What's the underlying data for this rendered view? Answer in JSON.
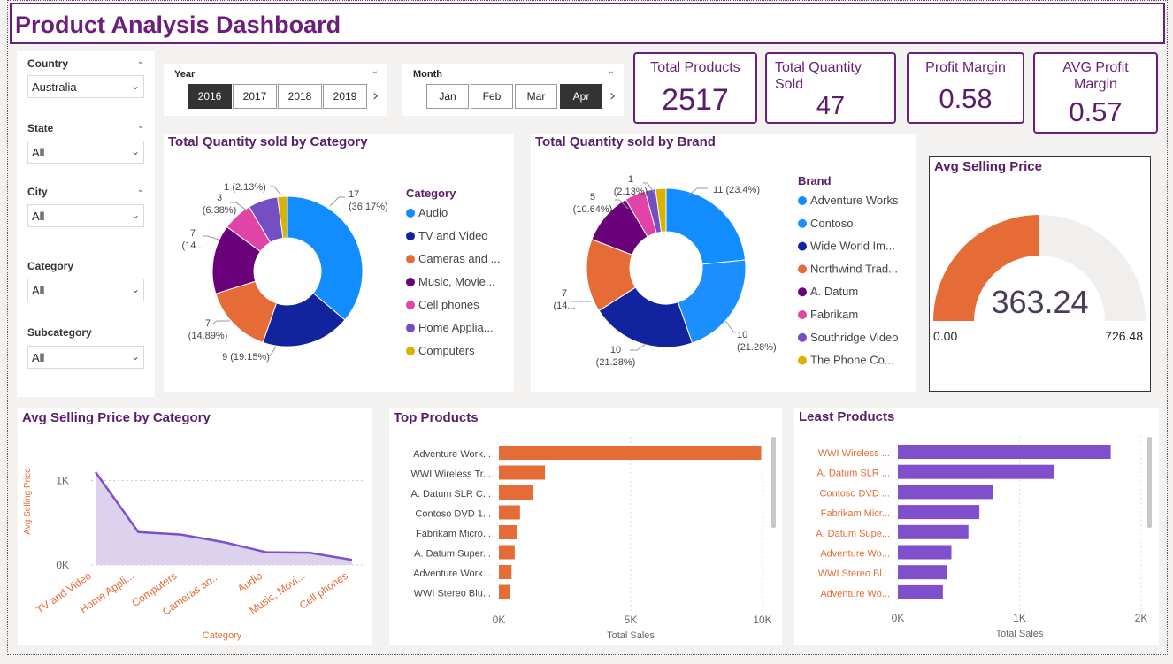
{
  "title": "Product Analysis Dashboard",
  "slicers": [
    {
      "label": "Country",
      "value": "Australia"
    },
    {
      "label": "State",
      "value": "All"
    },
    {
      "label": "City",
      "value": "All"
    },
    {
      "label": "Category",
      "value": "All"
    },
    {
      "label": "Subcategory",
      "value": "All"
    }
  ],
  "year": {
    "label": "Year",
    "options": [
      "2016",
      "2017",
      "2018",
      "2019"
    ],
    "selected": "2016"
  },
  "month": {
    "label": "Month",
    "options": [
      "Jan",
      "Feb",
      "Mar",
      "Apr"
    ],
    "selected": "Apr"
  },
  "kpis": [
    {
      "label": "Total Products",
      "value": "2517"
    },
    {
      "label": "Total Quantity Sold",
      "value": "47"
    },
    {
      "label": "Profit Margin",
      "value": "0.58"
    },
    {
      "label": "AVG Profit Margin",
      "value": "0.57"
    }
  ],
  "gauge": {
    "title": "Avg Selling Price",
    "value_text": "363.24",
    "min": "0.00",
    "max": "726.48",
    "fill_fraction": 0.5
  },
  "colors": {
    "accent": "#6b1e7a",
    "Audio": "#118dff",
    "TV and Video": "#12239e",
    "Cameras": "#e66c37",
    "Music": "#6b007b",
    "Cell phones": "#e044a7",
    "Home": "#744ec2",
    "Computers": "#d9b300",
    "orange_bar": "#e66c37",
    "purple_bar": "#7f4fcc"
  },
  "chart_data": [
    {
      "type": "pie",
      "title": "Total Quantity sold by Category",
      "legend_title": "Category",
      "categories": [
        "Audio",
        "TV and Video",
        "Cameras and ...",
        "Music, Movie...",
        "Cell phones",
        "Home Applia...",
        "Computers"
      ],
      "values": [
        17,
        9,
        7,
        7,
        3,
        3,
        1
      ],
      "labels": [
        {
          "l1": "17",
          "l2": "(36.17%)"
        },
        {
          "l1": "9 (19.15%)",
          "l2": ""
        },
        {
          "l1": "7",
          "l2": "(14.89%)"
        },
        {
          "l1": "7",
          "l2": "(14..."
        },
        {
          "l1": "3",
          "l2": "(6.38%)"
        },
        {
          "l1": "1 (2.13%)",
          "l2": ""
        }
      ]
    },
    {
      "type": "pie",
      "title": "Total Quantity sold by Brand",
      "legend_title": "Brand",
      "categories": [
        "Adventure Works",
        "Contoso",
        "Wide World Im...",
        "Northwind Trad...",
        "A. Datum",
        "Fabrikam",
        "Southridge Video",
        "The Phone Co..."
      ],
      "values": [
        11,
        10,
        10,
        7,
        5,
        2,
        1,
        1
      ],
      "labels": [
        {
          "l1": "11 (23.4%)",
          "l2": ""
        },
        {
          "l1": "10",
          "l2": "(21.28%)"
        },
        {
          "l1": "10",
          "l2": "(21.28%)"
        },
        {
          "l1": "7",
          "l2": "(14..."
        },
        {
          "l1": "5",
          "l2": "(10.64%)"
        },
        {
          "l1": "1",
          "l2": "(2.13%)"
        }
      ]
    },
    {
      "type": "area",
      "title": "Avg Selling Price by Category",
      "xlabel": "Category",
      "ylabel": "Avg Selling Price",
      "categories": [
        "TV and Video",
        "Home Appli...",
        "Computers",
        "Cameras an...",
        "Audio",
        "Music, Movi...",
        "Cell phones"
      ],
      "values": [
        1100,
        390,
        360,
        270,
        150,
        145,
        60
      ],
      "yticks": [
        "0K",
        "1K"
      ],
      "ylim": [
        0,
        1100
      ]
    },
    {
      "type": "bar",
      "title": "Top Products",
      "xlabel": "Total Sales",
      "categories": [
        "Adventure Work...",
        "WWI Wireless Tr...",
        "A. Datum SLR C...",
        "Contoso DVD 1...",
        "Fabrikam Micro...",
        "A. Datum Super...",
        "Adventure Work...",
        "WWI Stereo Blu..."
      ],
      "values": [
        9950,
        1750,
        1300,
        800,
        680,
        600,
        480,
        420
      ],
      "xticks": [
        "0K",
        "5K",
        "10K"
      ],
      "xlim": [
        0,
        10000
      ]
    },
    {
      "type": "bar",
      "title": "Least Products",
      "xlabel": "Total Sales",
      "categories": [
        "WWI Wireless ...",
        "A. Datum SLR ...",
        "Contoso DVD ...",
        "Fabrikam Micr...",
        "A. Datum Supe...",
        "Adventure Wo...",
        "WWI Stereo Bl...",
        "Adventure Wo..."
      ],
      "values": [
        1750,
        1280,
        780,
        670,
        580,
        440,
        400,
        370
      ],
      "xticks": [
        "0K",
        "1K",
        "2K"
      ],
      "xlim": [
        0,
        2000
      ]
    }
  ]
}
